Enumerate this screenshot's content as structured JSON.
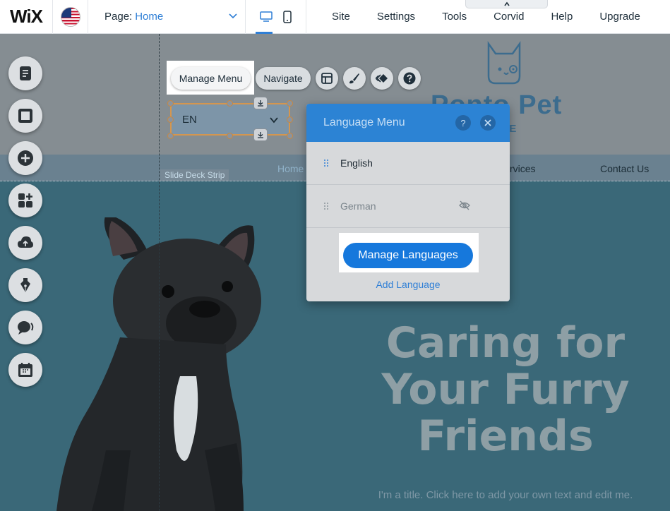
{
  "topbar": {
    "logo": "WiX",
    "page_label": "Page:",
    "page_value": "Home",
    "menu": [
      "Site",
      "Settings",
      "Tools",
      "Corvid",
      "Help",
      "Upgrade"
    ]
  },
  "site": {
    "brand_name": "Ponto Pet",
    "brand_sub": "STORE",
    "nav": {
      "home": "Home",
      "services": "rvices",
      "contact": "Contact Us"
    },
    "strip_label": "Slide Deck Strip",
    "hero_title": [
      "Caring for",
      "Your Furry",
      "Friends"
    ],
    "hero_subtitle": "I'm a title. Click here to add your own text and edit me."
  },
  "editor": {
    "manage_menu": "Manage Menu",
    "navigate": "Navigate",
    "selected_value": "EN",
    "left_tools": [
      "pages-icon",
      "background-icon",
      "add-icon",
      "add-apps-icon",
      "upload-icon",
      "blog-icon",
      "chat-icon",
      "bookings-icon"
    ]
  },
  "language_menu": {
    "title": "Language Menu",
    "help": "?",
    "languages": [
      {
        "name": "English",
        "hidden": false
      },
      {
        "name": "German",
        "hidden": true
      }
    ],
    "manage_languages": "Manage Languages",
    "add_language": "Add Language"
  },
  "colors": {
    "accent": "#2f7fd6",
    "panel_header": "#2c83d4",
    "primary_button": "#1678dc",
    "selection": "#d4964f"
  }
}
